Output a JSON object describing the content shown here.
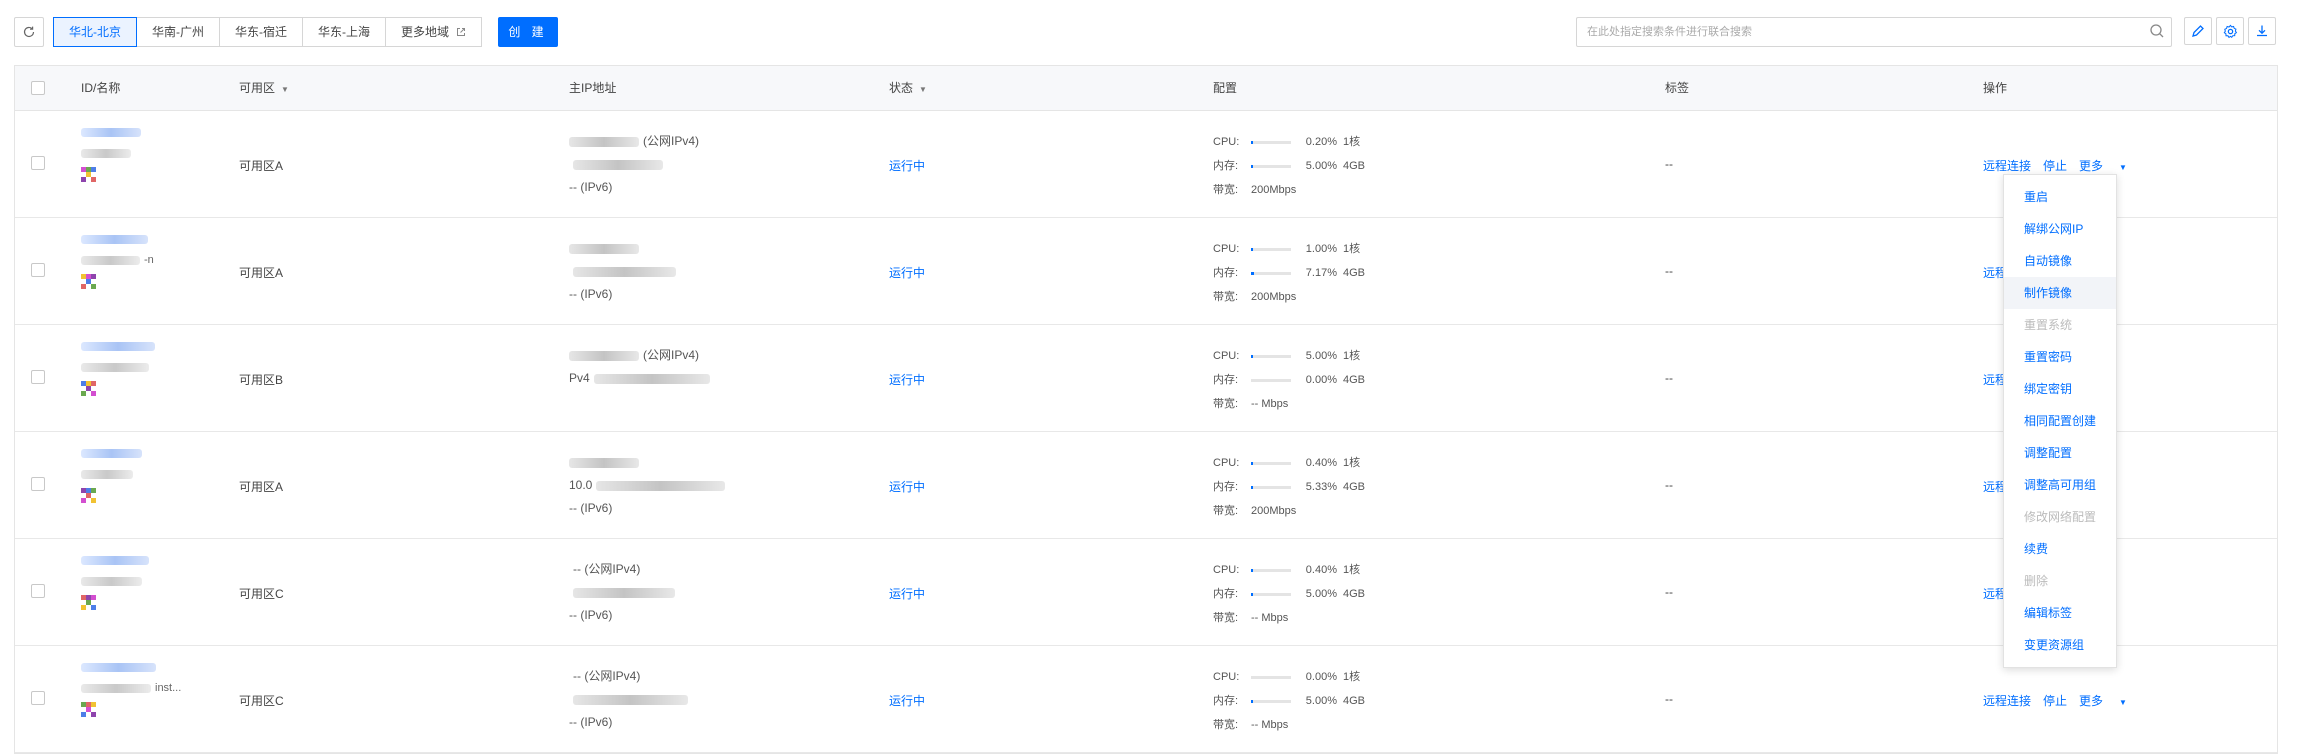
{
  "toolbar": {
    "regions": [
      {
        "label": "华北-北京",
        "active": true
      },
      {
        "label": "华南-广州",
        "active": false
      },
      {
        "label": "华东-宿迁",
        "active": false
      },
      {
        "label": "华东-上海",
        "active": false
      }
    ],
    "more_regions_label": "更多地域",
    "create_label": "创 建",
    "search_placeholder": "在此处指定搜索条件进行联合搜索",
    "icons": [
      "refresh-icon",
      "external-link-icon",
      "search-icon",
      "edit-icon",
      "settings-icon",
      "download-icon"
    ]
  },
  "table": {
    "headers": {
      "id": "ID/名称",
      "zone": "可用区",
      "ip": "主IP地址",
      "status": "状态",
      "config": "配置",
      "tags": "标签",
      "ops": "操作"
    },
    "rows": [
      {
        "id_tail": "",
        "zone": "可用区A",
        "ip_line1": "(公网IPv4)",
        "ip_line2": "",
        "ip_line3": "-- (IPv6)",
        "status": "运行中",
        "cpu_label": "CPU:",
        "cpu_pct": "0.20%",
        "cpu_spec": "1核",
        "cpu_fill": 0.002,
        "mem_label": "内存:",
        "mem_pct": "5.00%",
        "mem_spec": "4GB",
        "mem_fill": 0.05,
        "bw_label": "带宽:",
        "bw_value": "200Mbps",
        "tags": "--",
        "op_connect": "远程连接",
        "op_stop": "停止",
        "op_more": "更多"
      },
      {
        "id_tail": "-n",
        "zone": "可用区A",
        "ip_line1": "",
        "ip_line2": "",
        "ip_line3": "-- (IPv6)",
        "status": "运行中",
        "cpu_label": "CPU:",
        "cpu_pct": "1.00%",
        "cpu_spec": "1核",
        "cpu_fill": 0.01,
        "mem_label": "内存:",
        "mem_pct": "7.17%",
        "mem_spec": "4GB",
        "mem_fill": 0.0717,
        "bw_label": "带宽:",
        "bw_value": "200Mbps",
        "tags": "--",
        "op_connect": "远程连",
        "op_stop": "",
        "op_more": ""
      },
      {
        "id_tail": "",
        "zone": "可用区B",
        "ip_line1": "(公网IPv4)",
        "ip_line2": "Pv4",
        "ip_line3": "",
        "status": "运行中",
        "cpu_label": "CPU:",
        "cpu_pct": "5.00%",
        "cpu_spec": "1核",
        "cpu_fill": 0.05,
        "mem_label": "内存:",
        "mem_pct": "0.00%",
        "mem_spec": "4GB",
        "mem_fill": 0.0,
        "bw_label": "带宽:",
        "bw_value": "-- Mbps",
        "tags": "--",
        "op_connect": "远程连",
        "op_stop": "",
        "op_more": ""
      },
      {
        "id_tail": "",
        "zone": "可用区A",
        "ip_line1": "",
        "ip_line2": "10.0",
        "ip_line3": "-- (IPv6)",
        "status": "运行中",
        "cpu_label": "CPU:",
        "cpu_pct": "0.40%",
        "cpu_spec": "1核",
        "cpu_fill": 0.004,
        "mem_label": "内存:",
        "mem_pct": "5.33%",
        "mem_spec": "4GB",
        "mem_fill": 0.0533,
        "bw_label": "带宽:",
        "bw_value": "200Mbps",
        "tags": "--",
        "op_connect": "远程连",
        "op_stop": "",
        "op_more": ""
      },
      {
        "id_tail": "",
        "zone": "可用区C",
        "ip_line1": "-- (公网IPv4)",
        "ip_line2": "",
        "ip_line3": "-- (IPv6)",
        "status": "运行中",
        "cpu_label": "CPU:",
        "cpu_pct": "0.40%",
        "cpu_spec": "1核",
        "cpu_fill": 0.004,
        "mem_label": "内存:",
        "mem_pct": "5.00%",
        "mem_spec": "4GB",
        "mem_fill": 0.05,
        "bw_label": "带宽:",
        "bw_value": "-- Mbps",
        "tags": "--",
        "op_connect": "远程连",
        "op_stop": "",
        "op_more": ""
      },
      {
        "id_tail": "inst...",
        "zone": "可用区C",
        "ip_line1": "-- (公网IPv4)",
        "ip_line2": "",
        "ip_line3": "-- (IPv6)",
        "status": "运行中",
        "cpu_label": "CPU:",
        "cpu_pct": "0.00%",
        "cpu_spec": "1核",
        "cpu_fill": 0.0,
        "mem_label": "内存:",
        "mem_pct": "5.00%",
        "mem_spec": "4GB",
        "mem_fill": 0.05,
        "bw_label": "带宽:",
        "bw_value": "-- Mbps",
        "tags": "--",
        "op_connect": "远程连接",
        "op_stop": "停止",
        "op_more": "更多"
      }
    ]
  },
  "more_menu": {
    "items": [
      {
        "label": "重启",
        "disabled": false
      },
      {
        "label": "解绑公网IP",
        "disabled": false
      },
      {
        "label": "自动镜像",
        "disabled": false
      },
      {
        "label": "制作镜像",
        "disabled": false,
        "hover": true
      },
      {
        "label": "重置系统",
        "disabled": true
      },
      {
        "label": "重置密码",
        "disabled": false
      },
      {
        "label": "绑定密钥",
        "disabled": false
      },
      {
        "label": "相同配置创建",
        "disabled": false
      },
      {
        "label": "调整配置",
        "disabled": false
      },
      {
        "label": "调整高可用组",
        "disabled": false
      },
      {
        "label": "修改网络配置",
        "disabled": true
      },
      {
        "label": "续费",
        "disabled": false
      },
      {
        "label": "删除",
        "disabled": true
      },
      {
        "label": "编辑标签",
        "disabled": false
      },
      {
        "label": "变更资源组",
        "disabled": false
      }
    ]
  },
  "colors": {
    "accent": "#006eff",
    "disabled": "#bbbbbb",
    "header_bg": "#f7f8fa"
  }
}
